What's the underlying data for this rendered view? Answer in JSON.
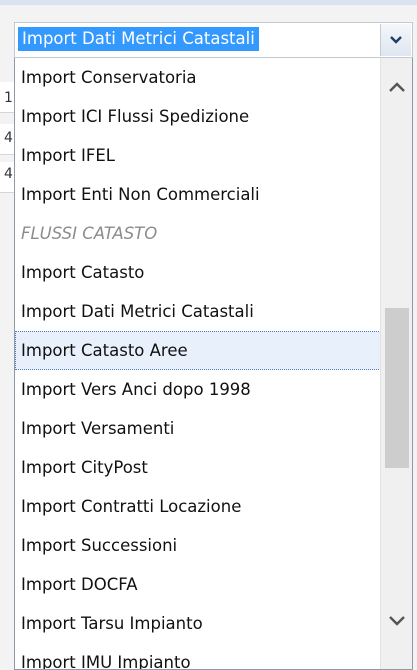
{
  "combo": {
    "selected_value": "Import Dati Metrici Catastali"
  },
  "dropdown": {
    "items": [
      {
        "label": "Import Conservatoria"
      },
      {
        "label": "Import ICI Flussi Spedizione"
      },
      {
        "label": "Import IFEL"
      },
      {
        "label": "Import Enti Non Commerciali"
      },
      {
        "label": "FLUSSI CATASTO"
      },
      {
        "label": "Import Catasto"
      },
      {
        "label": "Import Dati Metrici Catastali"
      },
      {
        "label": "Import Catasto Aree"
      },
      {
        "label": "Import Vers Anci dopo 1998"
      },
      {
        "label": "Import Versamenti"
      },
      {
        "label": "Import CityPost"
      },
      {
        "label": "Import Contratti Locazione"
      },
      {
        "label": "Import Successioni"
      },
      {
        "label": "Import DOCFA"
      },
      {
        "label": "Import Tarsu Impianto"
      },
      {
        "label": "Import IMU Impianto"
      }
    ]
  },
  "background": {
    "digits": [
      "1",
      "4",
      "4"
    ]
  },
  "icons": {
    "combo_arrow": "chevron-down-icon",
    "scroll_up": "chevron-up-icon",
    "scroll_down": "chevron-down-icon"
  },
  "colors": {
    "selection": "#3399ff",
    "hover_row": "#e8f1fb",
    "scroll_thumb": "#cdcdcd"
  }
}
